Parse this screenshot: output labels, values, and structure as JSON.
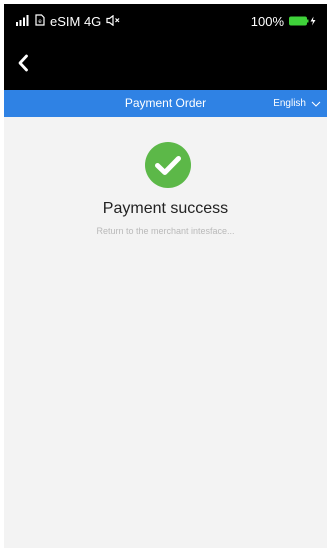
{
  "status_bar": {
    "carrier": "eSIM 4G",
    "battery": "100%"
  },
  "nav": {
    "title": "Payment Order",
    "language": "English"
  },
  "result": {
    "title": "Payment success",
    "subtitle": "Return to the merchant intesface..."
  },
  "icons": {
    "signal": "signal-bars-icon",
    "sim": "sim-card-icon",
    "mute": "muted-speaker-icon",
    "battery": "battery-charging-icon",
    "back": "chevron-left-icon",
    "dropdown": "chevron-down-icon",
    "success": "check-circle-icon"
  },
  "colors": {
    "nav_bar": "#2f82e4",
    "success": "#5cb848",
    "battery": "#3fd23a",
    "page_bg": "#f3f3f3"
  }
}
